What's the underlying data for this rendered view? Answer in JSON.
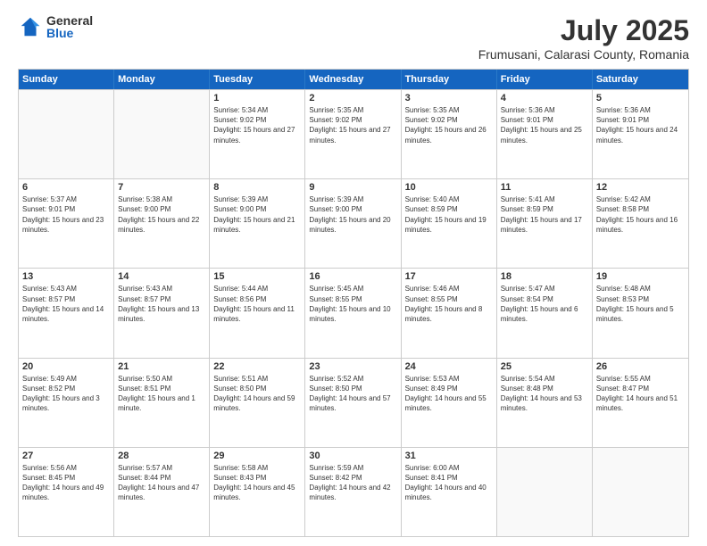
{
  "header": {
    "logo_general": "General",
    "logo_blue": "Blue",
    "month_title": "July 2025",
    "location": "Frumusani, Calarasi County, Romania"
  },
  "days_of_week": [
    "Sunday",
    "Monday",
    "Tuesday",
    "Wednesday",
    "Thursday",
    "Friday",
    "Saturday"
  ],
  "weeks": [
    [
      {
        "day": "",
        "info": ""
      },
      {
        "day": "",
        "info": ""
      },
      {
        "day": "1",
        "info": "Sunrise: 5:34 AM\nSunset: 9:02 PM\nDaylight: 15 hours and 27 minutes."
      },
      {
        "day": "2",
        "info": "Sunrise: 5:35 AM\nSunset: 9:02 PM\nDaylight: 15 hours and 27 minutes."
      },
      {
        "day": "3",
        "info": "Sunrise: 5:35 AM\nSunset: 9:02 PM\nDaylight: 15 hours and 26 minutes."
      },
      {
        "day": "4",
        "info": "Sunrise: 5:36 AM\nSunset: 9:01 PM\nDaylight: 15 hours and 25 minutes."
      },
      {
        "day": "5",
        "info": "Sunrise: 5:36 AM\nSunset: 9:01 PM\nDaylight: 15 hours and 24 minutes."
      }
    ],
    [
      {
        "day": "6",
        "info": "Sunrise: 5:37 AM\nSunset: 9:01 PM\nDaylight: 15 hours and 23 minutes."
      },
      {
        "day": "7",
        "info": "Sunrise: 5:38 AM\nSunset: 9:00 PM\nDaylight: 15 hours and 22 minutes."
      },
      {
        "day": "8",
        "info": "Sunrise: 5:39 AM\nSunset: 9:00 PM\nDaylight: 15 hours and 21 minutes."
      },
      {
        "day": "9",
        "info": "Sunrise: 5:39 AM\nSunset: 9:00 PM\nDaylight: 15 hours and 20 minutes."
      },
      {
        "day": "10",
        "info": "Sunrise: 5:40 AM\nSunset: 8:59 PM\nDaylight: 15 hours and 19 minutes."
      },
      {
        "day": "11",
        "info": "Sunrise: 5:41 AM\nSunset: 8:59 PM\nDaylight: 15 hours and 17 minutes."
      },
      {
        "day": "12",
        "info": "Sunrise: 5:42 AM\nSunset: 8:58 PM\nDaylight: 15 hours and 16 minutes."
      }
    ],
    [
      {
        "day": "13",
        "info": "Sunrise: 5:43 AM\nSunset: 8:57 PM\nDaylight: 15 hours and 14 minutes."
      },
      {
        "day": "14",
        "info": "Sunrise: 5:43 AM\nSunset: 8:57 PM\nDaylight: 15 hours and 13 minutes."
      },
      {
        "day": "15",
        "info": "Sunrise: 5:44 AM\nSunset: 8:56 PM\nDaylight: 15 hours and 11 minutes."
      },
      {
        "day": "16",
        "info": "Sunrise: 5:45 AM\nSunset: 8:55 PM\nDaylight: 15 hours and 10 minutes."
      },
      {
        "day": "17",
        "info": "Sunrise: 5:46 AM\nSunset: 8:55 PM\nDaylight: 15 hours and 8 minutes."
      },
      {
        "day": "18",
        "info": "Sunrise: 5:47 AM\nSunset: 8:54 PM\nDaylight: 15 hours and 6 minutes."
      },
      {
        "day": "19",
        "info": "Sunrise: 5:48 AM\nSunset: 8:53 PM\nDaylight: 15 hours and 5 minutes."
      }
    ],
    [
      {
        "day": "20",
        "info": "Sunrise: 5:49 AM\nSunset: 8:52 PM\nDaylight: 15 hours and 3 minutes."
      },
      {
        "day": "21",
        "info": "Sunrise: 5:50 AM\nSunset: 8:51 PM\nDaylight: 15 hours and 1 minute."
      },
      {
        "day": "22",
        "info": "Sunrise: 5:51 AM\nSunset: 8:50 PM\nDaylight: 14 hours and 59 minutes."
      },
      {
        "day": "23",
        "info": "Sunrise: 5:52 AM\nSunset: 8:50 PM\nDaylight: 14 hours and 57 minutes."
      },
      {
        "day": "24",
        "info": "Sunrise: 5:53 AM\nSunset: 8:49 PM\nDaylight: 14 hours and 55 minutes."
      },
      {
        "day": "25",
        "info": "Sunrise: 5:54 AM\nSunset: 8:48 PM\nDaylight: 14 hours and 53 minutes."
      },
      {
        "day": "26",
        "info": "Sunrise: 5:55 AM\nSunset: 8:47 PM\nDaylight: 14 hours and 51 minutes."
      }
    ],
    [
      {
        "day": "27",
        "info": "Sunrise: 5:56 AM\nSunset: 8:45 PM\nDaylight: 14 hours and 49 minutes."
      },
      {
        "day": "28",
        "info": "Sunrise: 5:57 AM\nSunset: 8:44 PM\nDaylight: 14 hours and 47 minutes."
      },
      {
        "day": "29",
        "info": "Sunrise: 5:58 AM\nSunset: 8:43 PM\nDaylight: 14 hours and 45 minutes."
      },
      {
        "day": "30",
        "info": "Sunrise: 5:59 AM\nSunset: 8:42 PM\nDaylight: 14 hours and 42 minutes."
      },
      {
        "day": "31",
        "info": "Sunrise: 6:00 AM\nSunset: 8:41 PM\nDaylight: 14 hours and 40 minutes."
      },
      {
        "day": "",
        "info": ""
      },
      {
        "day": "",
        "info": ""
      }
    ]
  ]
}
